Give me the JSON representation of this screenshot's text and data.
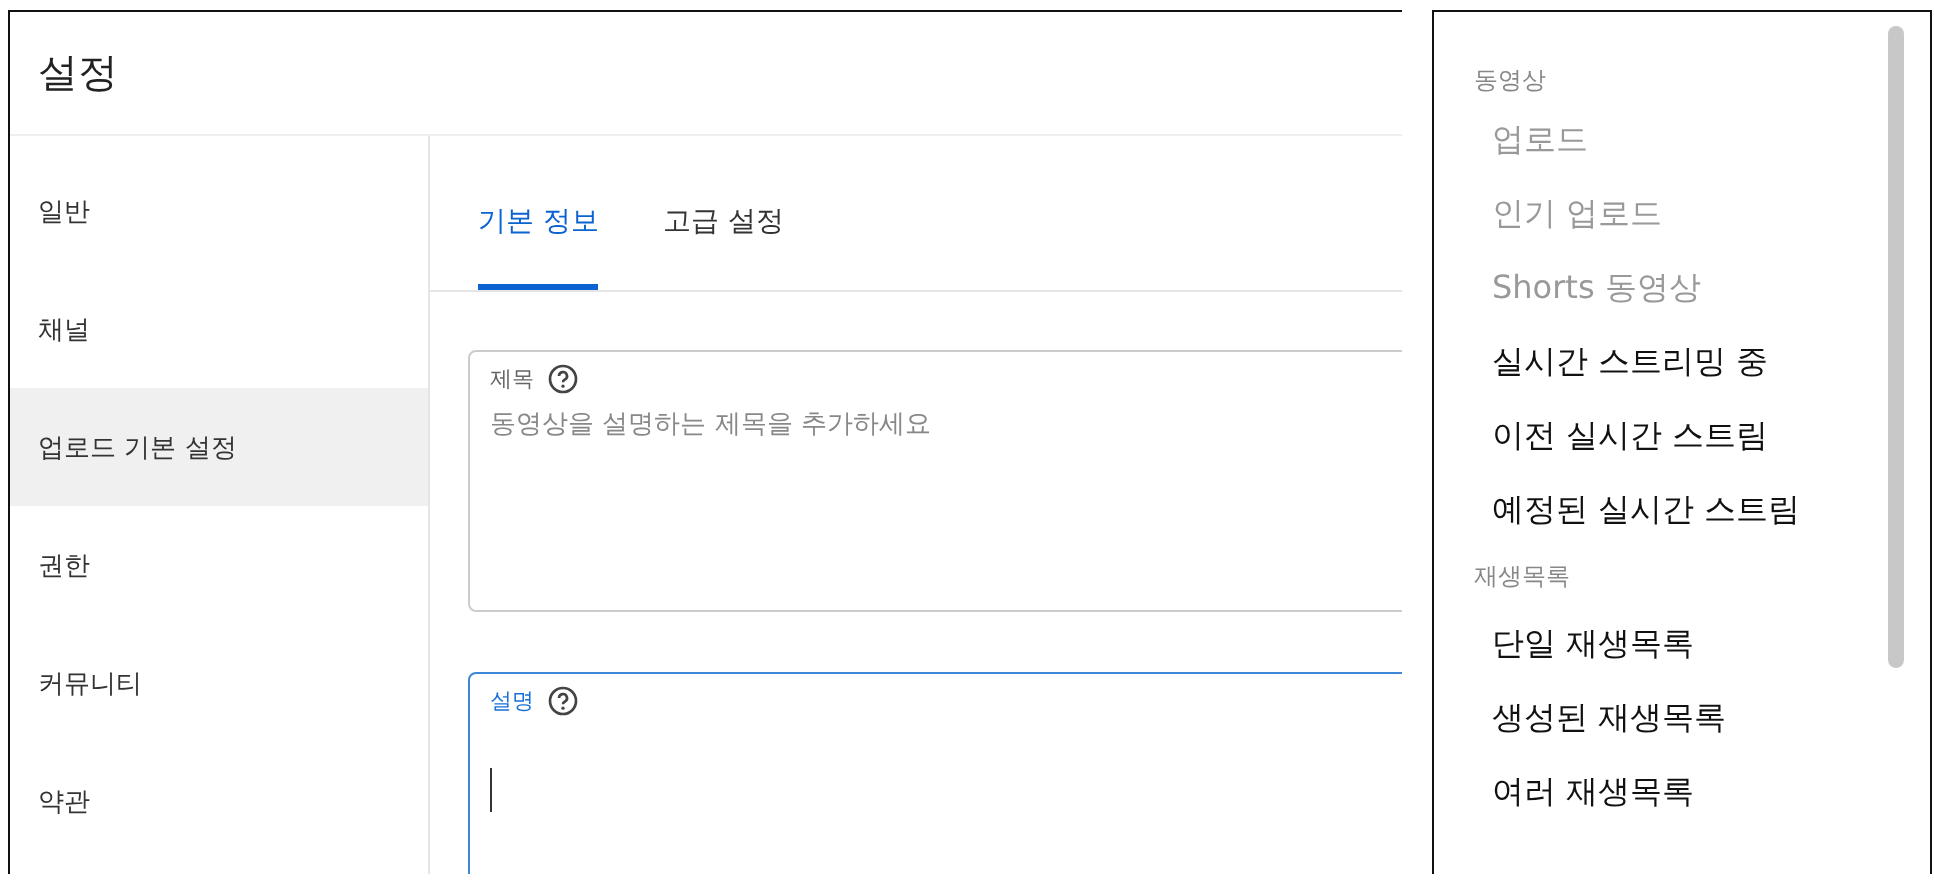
{
  "settings": {
    "title": "설정",
    "sidebar": {
      "items": [
        {
          "label": "일반",
          "selected": false
        },
        {
          "label": "채널",
          "selected": false
        },
        {
          "label": "업로드 기본 설정",
          "selected": true
        },
        {
          "label": "권한",
          "selected": false
        },
        {
          "label": "커뮤니티",
          "selected": false
        },
        {
          "label": "약관",
          "selected": false
        }
      ]
    },
    "tabs": [
      {
        "label": "기본 정보",
        "selected": true
      },
      {
        "label": "고급 설정",
        "selected": false
      }
    ],
    "fields": [
      {
        "label": "제목",
        "placeholder": "동영상을 설명하는 제목을 추가하세요",
        "focused": false
      },
      {
        "label": "설명",
        "focused": true
      }
    ]
  },
  "menu": {
    "sections": [
      {
        "heading": "동영상",
        "items": [
          {
            "label": "업로드",
            "disabled": true
          },
          {
            "label": "인기 업로드",
            "disabled": true
          },
          {
            "label": "Shorts 동영상",
            "disabled": true
          },
          {
            "label": "실시간 스트리밍 중",
            "disabled": false
          },
          {
            "label": "이전 실시간 스트림",
            "disabled": false
          },
          {
            "label": "예정된 실시간 스트림",
            "disabled": false
          }
        ]
      },
      {
        "heading": "재생목록",
        "items": [
          {
            "label": "단일 재생목록",
            "disabled": false
          },
          {
            "label": "생성된 재생목록",
            "disabled": false
          },
          {
            "label": "여러 재생목록",
            "disabled": false
          }
        ]
      }
    ]
  }
}
